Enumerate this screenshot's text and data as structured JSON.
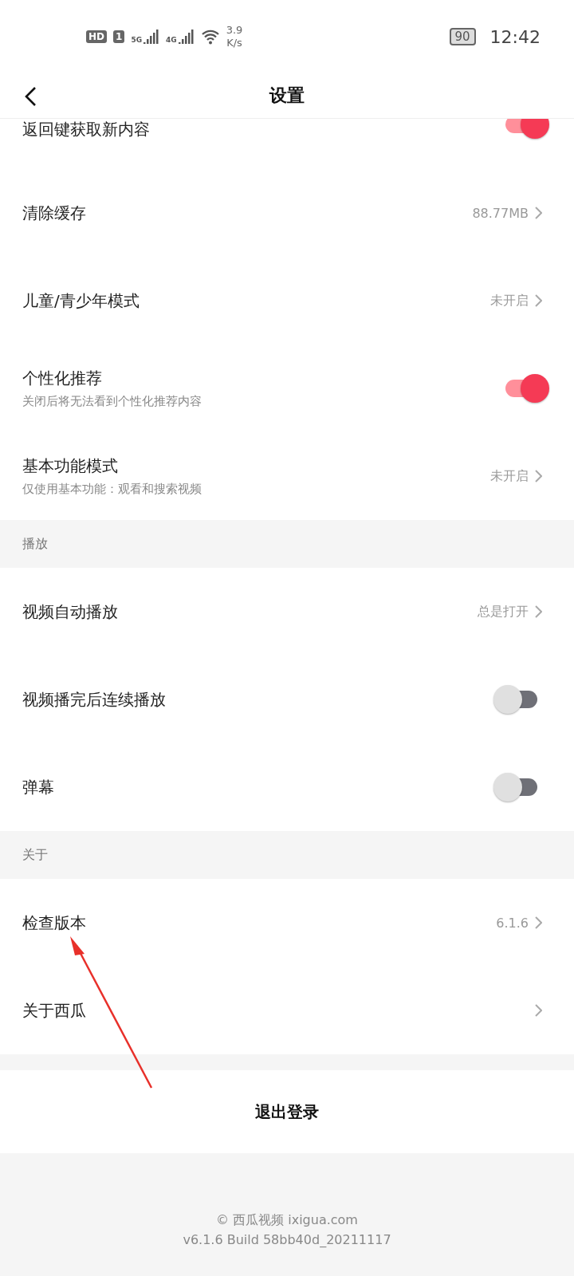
{
  "status_bar": {
    "hd_badge": "HD",
    "sim_badge": "1",
    "signals": [
      "5G",
      "4G"
    ],
    "speed": [
      "3.9",
      "K/s"
    ],
    "battery": "90",
    "time": "12:42"
  },
  "header": {
    "title": "设置"
  },
  "sections": [
    {
      "items": [
        {
          "kind": "toggle",
          "label": "返回键获取新内容",
          "on": true,
          "cut": true
        },
        {
          "kind": "link",
          "label": "清除缓存",
          "value": "88.77MB"
        },
        {
          "kind": "link",
          "label": "儿童/青少年模式",
          "value": "未开启"
        },
        {
          "kind": "toggle",
          "label": "个性化推荐",
          "subtitle": "关闭后将无法看到个性化推荐内容",
          "on": true
        },
        {
          "kind": "link",
          "label": "基本功能模式",
          "subtitle": "仅使用基本功能：观看和搜索视频",
          "value": "未开启"
        }
      ]
    },
    {
      "title": "播放",
      "items": [
        {
          "kind": "link",
          "label": "视频自动播放",
          "value": "总是打开"
        },
        {
          "kind": "toggle",
          "label": "视频播完后连续播放",
          "on": false
        },
        {
          "kind": "toggle",
          "label": "弹幕",
          "on": false
        }
      ]
    },
    {
      "title": "关于",
      "items": [
        {
          "kind": "link",
          "label": "检查版本",
          "value": "6.1.6"
        },
        {
          "kind": "link",
          "label": "关于西瓜"
        }
      ]
    }
  ],
  "logout_button": "退出登录",
  "footer": [
    "© 西瓜视频 ixigua.com",
    "v6.1.6 Build 58bb40d_20211117"
  ]
}
